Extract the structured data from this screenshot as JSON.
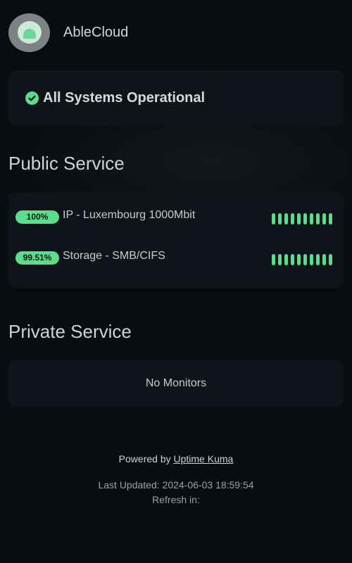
{
  "header": {
    "app_title": "AbleCloud",
    "logo_icon": "uptime-kuma-logo"
  },
  "status": {
    "text": "All Systems Operational",
    "icon": "check-circle-icon",
    "color": "#5cdd8b"
  },
  "public_service": {
    "title": "Public Service",
    "monitors": [
      {
        "uptime": "100%",
        "name": "IP - Luxembourg 1000Mbit",
        "beats_up": 10
      },
      {
        "uptime": "99.51%",
        "name": "Storage - SMB/CIFS",
        "beats_up": 10
      }
    ]
  },
  "private_service": {
    "title": "Private Service",
    "empty_text": "No Monitors"
  },
  "footer": {
    "powered_prefix": "Powered by",
    "powered_link": "Uptime Kuma",
    "last_updated": "Last Updated: 2024-06-03 18:59:54",
    "refresh": "Refresh in:"
  },
  "colors": {
    "background": "#090c10",
    "card": "#0f131a",
    "accent_green": "#5cdd8b"
  }
}
